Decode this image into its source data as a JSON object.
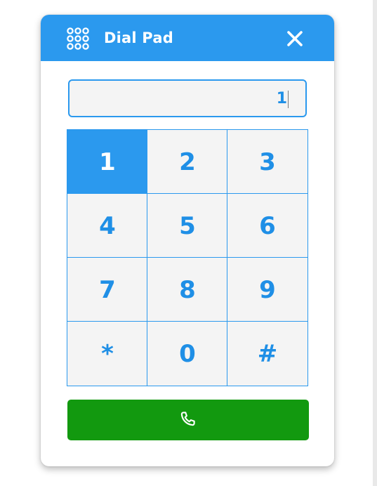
{
  "header": {
    "title": "Dial Pad",
    "menu_icon": "grid-dots-icon",
    "close_icon": "close-icon",
    "color": "#2b99ee"
  },
  "display": {
    "value": "1"
  },
  "keypad": {
    "keys": [
      "1",
      "2",
      "3",
      "4",
      "5",
      "6",
      "7",
      "8",
      "9",
      "*",
      "0",
      "#"
    ],
    "active_key": "1",
    "accent_color": "#2b99ee"
  },
  "call_button": {
    "icon": "phone-icon",
    "color": "#12990f"
  }
}
